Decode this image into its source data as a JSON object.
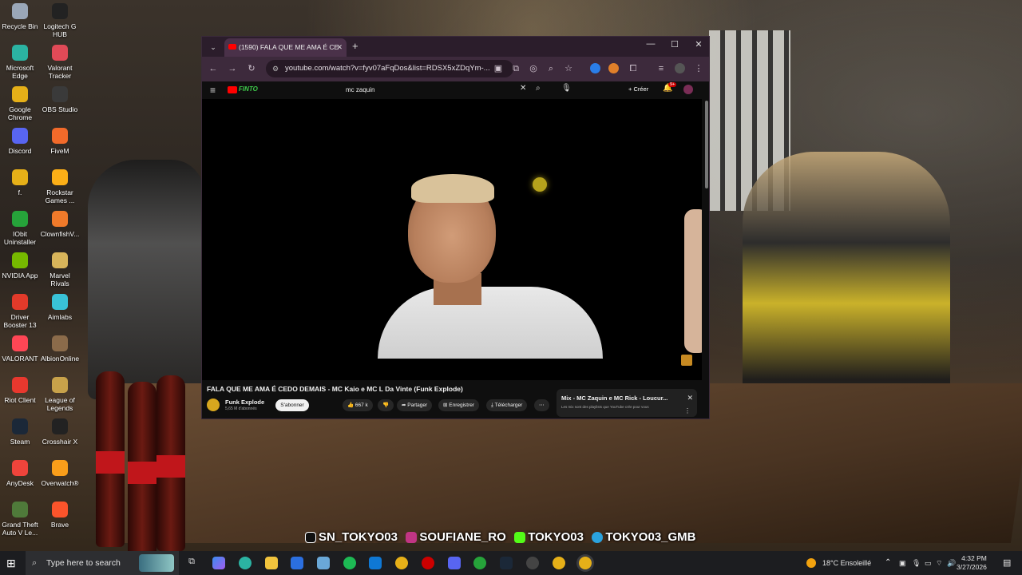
{
  "desktop": {
    "icons": [
      {
        "label": "Recycle Bin",
        "icon": "recycle-bin-icon",
        "color": "#9aa7b8"
      },
      {
        "label": "Logitech G HUB",
        "icon": "logitech-icon",
        "color": "#222222"
      },
      {
        "label": "Microsoft Edge",
        "icon": "edge-icon",
        "color": "#2bb3a2"
      },
      {
        "label": "Valorant Tracker",
        "icon": "valorant-tracker-icon",
        "color": "#e04a57"
      },
      {
        "label": "Google Chrome",
        "icon": "chrome-icon",
        "color": "#e6b018"
      },
      {
        "label": "OBS Studio",
        "icon": "obs-icon",
        "color": "#3a3a3a"
      },
      {
        "label": "Discord",
        "icon": "discord-icon",
        "color": "#5865f2"
      },
      {
        "label": "FiveM",
        "icon": "fivem-icon",
        "color": "#f26a2a"
      },
      {
        "label": "f.",
        "icon": "chrome-profile-icon",
        "color": "#e6b018"
      },
      {
        "label": "Rockstar Games ...",
        "icon": "rockstar-icon",
        "color": "#fcaf17"
      },
      {
        "label": "IObit Uninstaller",
        "icon": "iobit-icon",
        "color": "#26a33a"
      },
      {
        "label": "ClownfishV...",
        "icon": "clownfish-icon",
        "color": "#f07a2a"
      },
      {
        "label": "NVIDIA App",
        "icon": "nvidia-icon",
        "color": "#76b900"
      },
      {
        "label": "Marvel Rivals",
        "icon": "marvel-rivals-icon",
        "color": "#d7b45a"
      },
      {
        "label": "Driver Booster 13",
        "icon": "driver-booster-icon",
        "color": "#e23a2a"
      },
      {
        "label": "Aimlabs",
        "icon": "aimlabs-icon",
        "color": "#39c2d7"
      },
      {
        "label": "VALORANT",
        "icon": "valorant-icon",
        "color": "#ff4655"
      },
      {
        "label": "AlbionOnline",
        "icon": "albion-icon",
        "color": "#8b6b4a"
      },
      {
        "label": "Riot Client",
        "icon": "riot-client-icon",
        "color": "#e8382e"
      },
      {
        "label": "League of Legends",
        "icon": "league-icon",
        "color": "#c8a24a"
      },
      {
        "label": "Steam",
        "icon": "steam-icon",
        "color": "#1b2838"
      },
      {
        "label": "Crosshair X",
        "icon": "crosshair-icon",
        "color": "#222222"
      },
      {
        "label": "AnyDesk",
        "icon": "anydesk-icon",
        "color": "#ef443b"
      },
      {
        "label": "Overwatch®",
        "icon": "overwatch-icon",
        "color": "#f99e1a"
      },
      {
        "label": "Grand Theft Auto V Le...",
        "icon": "gta-icon",
        "color": "#4f7a3a"
      },
      {
        "label": "Brave",
        "icon": "brave-icon",
        "color": "#fb542b"
      }
    ]
  },
  "browser": {
    "tab_title": "(1590) FALA QUE ME AMA É CE",
    "url": "youtube.com/watch?v=fyv07aFqDos&list=RDSX5xZDqYm-...",
    "colors": {
      "frame": "#2b1d2b",
      "toolbar": "#3d2a3c",
      "tab_active": "#4a3149"
    }
  },
  "youtube": {
    "logo_text": "FINTO",
    "search_value": "mc zaquin",
    "create_label": "Créer",
    "notif_badge": "9+",
    "video_title": "FALA QUE ME AMA É CEDO DEMAIS - MC Kaio e MC L Da Vinte (Funk Explode)",
    "channel_name": "Funk Explode",
    "channel_subs": "5,65 M d'abonnés",
    "subscribe_label": "S'abonner",
    "like_count": "667 k",
    "share_label": "Partager",
    "save_label": "Enregistrer",
    "download_label": "Télécharger",
    "mix_title": "Mix - MC Zaquin e MC Rick - Loucur...",
    "mix_subtitle": "Les mix sont des playlists que YouTube crée pour vous"
  },
  "social": {
    "tiktok": "SN_TOKYO03",
    "instagram": "SOUFIANE_RO",
    "kick": "TOKYO03",
    "telegram": "TOKYO03_GMB"
  },
  "taskbar": {
    "search_placeholder": "Type here to search",
    "weather": "18°C Ensoleillé",
    "time": "4:32 PM",
    "date": "3/27/2026"
  }
}
